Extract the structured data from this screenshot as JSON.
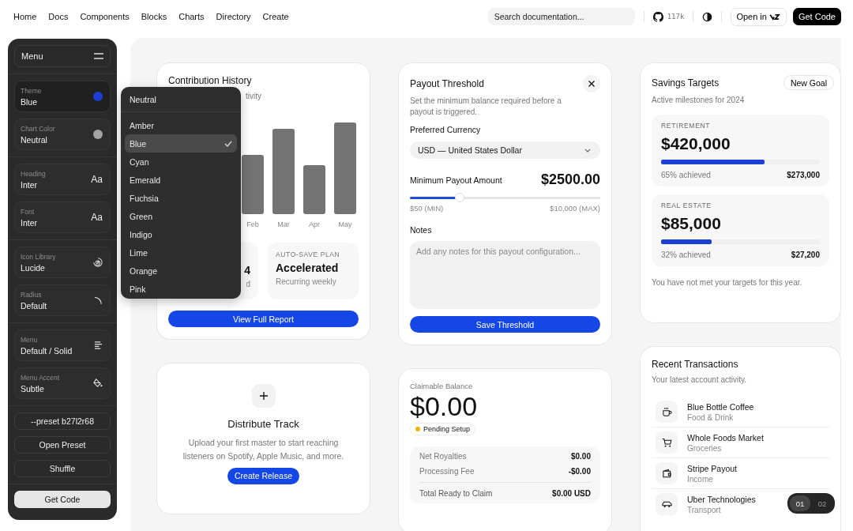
{
  "nav": {
    "links": [
      "Home",
      "Docs",
      "Components",
      "Blocks",
      "Charts",
      "Directory",
      "Create"
    ],
    "search": {
      "placeholder": "Search documentation..."
    },
    "stars": "117k",
    "open_in": "Open in",
    "get_code": "Get Code"
  },
  "customizer": {
    "title": "Menu",
    "groups": [
      [
        {
          "label": "Theme",
          "value": "Blue",
          "kind": "swatch",
          "color": "#1d3fd6",
          "selected": true
        },
        {
          "label": "Chart Color",
          "value": "Neutral",
          "kind": "swatch",
          "color": "#a3a3a3",
          "selected": false
        }
      ],
      [
        {
          "label": "Heading",
          "value": "Inter",
          "kind": "glyph",
          "glyph": "Aa",
          "selected": false
        },
        {
          "label": "Font",
          "value": "Inter",
          "kind": "glyph",
          "glyph": "Aa",
          "selected": false
        }
      ],
      [
        {
          "label": "Icon Library",
          "value": "Lucide",
          "kind": "spiral",
          "selected": false
        },
        {
          "label": "Radius",
          "value": "Default",
          "kind": "corner",
          "selected": false
        }
      ],
      [
        {
          "label": "Menu",
          "value": "Default / Solid",
          "kind": "lines",
          "selected": false
        },
        {
          "label": "Menu Accent",
          "value": "Subtle",
          "kind": "paint",
          "selected": false
        }
      ]
    ],
    "preset": "--preset b27l2r68",
    "buttons": [
      "Open Preset",
      "Shuffle"
    ],
    "get_code": "Get Code"
  },
  "dropdown": {
    "header": "Neutral",
    "options": [
      {
        "label": "Amber",
        "selected": false
      },
      {
        "label": "Blue",
        "selected": true
      },
      {
        "label": "Cyan",
        "selected": false
      },
      {
        "label": "Emerald",
        "selected": false
      },
      {
        "label": "Fuchsia",
        "selected": false
      },
      {
        "label": "Green",
        "selected": false
      },
      {
        "label": "Indigo",
        "selected": false
      },
      {
        "label": "Lime",
        "selected": false
      },
      {
        "label": "Orange",
        "selected": false
      },
      {
        "label": "Pink",
        "selected": false
      }
    ]
  },
  "contribution": {
    "title": "Contribution History",
    "subtitle": "tivity",
    "months": [
      "Feb",
      "Mar",
      "Apr",
      "May"
    ],
    "stats": [
      {
        "value": "4",
        "note": "d"
      },
      {
        "label": "AUTO-SAVE PLAN",
        "value": "Accelerated",
        "note": "Recurring weekly"
      }
    ],
    "button": "View Full Report"
  },
  "payout": {
    "title": "Payout Threshold",
    "description": "Set the minimum balance required before a payout is triggered.",
    "currency_label": "Preferred Currency",
    "currency": "USD — United States Dollar",
    "amount_label": "Minimum Payout Amount",
    "amount": "$2500.00",
    "level": 0.26,
    "min": "$50 (MIN)",
    "max": "$10,000 (MAX)",
    "notes_label": "Notes",
    "notes_placeholder": "Add any notes for this payout configuration...",
    "button": "Save Threshold"
  },
  "savings": {
    "title": "Savings Targets",
    "subtitle": "Active milestones for 2024",
    "button": "New Goal",
    "goals": [
      {
        "label": "RETIREMENT",
        "amount": "$420,000",
        "level": 0.65,
        "achieved": "65% achieved",
        "saved": "$273,000"
      },
      {
        "label": "REAL ESTATE",
        "amount": "$85,000",
        "level": 0.32,
        "achieved": "32% achieved",
        "saved": "$27,200"
      }
    ],
    "footer": "You have not met your targets for this year."
  },
  "distribute": {
    "title": "Distribute Track",
    "description": "Upload your first master to start reaching listeners on Spotify, Apple Music, and more.",
    "button": "Create Release"
  },
  "claimable": {
    "label": "Claimable Balance",
    "amount": "$0.00",
    "badge": {
      "text": "Pending Setup",
      "color": "#f0b400"
    },
    "rows": [
      {
        "label": "Net Royalties",
        "value": "$0.00"
      },
      {
        "label": "Processing Fee",
        "value": "-$0.00"
      }
    ],
    "total": {
      "label": "Total Ready to Claim",
      "value": "$0.00 USD"
    }
  },
  "transactions": {
    "title": "Recent Transactions",
    "subtitle": "Your latest account activity.",
    "items": [
      {
        "name": "Blue Bottle Coffee",
        "category": "Food & Drink",
        "kind": "cup"
      },
      {
        "name": "Whole Foods Market",
        "category": "Groceries",
        "kind": "cart"
      },
      {
        "name": "Stripe Payout",
        "category": "Income",
        "kind": "wallet"
      },
      {
        "name": "Uber Technologies",
        "category": "Transport",
        "kind": "car"
      }
    ]
  },
  "pager": [
    {
      "label": "01",
      "selected": true
    },
    {
      "label": "02",
      "selected": false
    }
  ]
}
